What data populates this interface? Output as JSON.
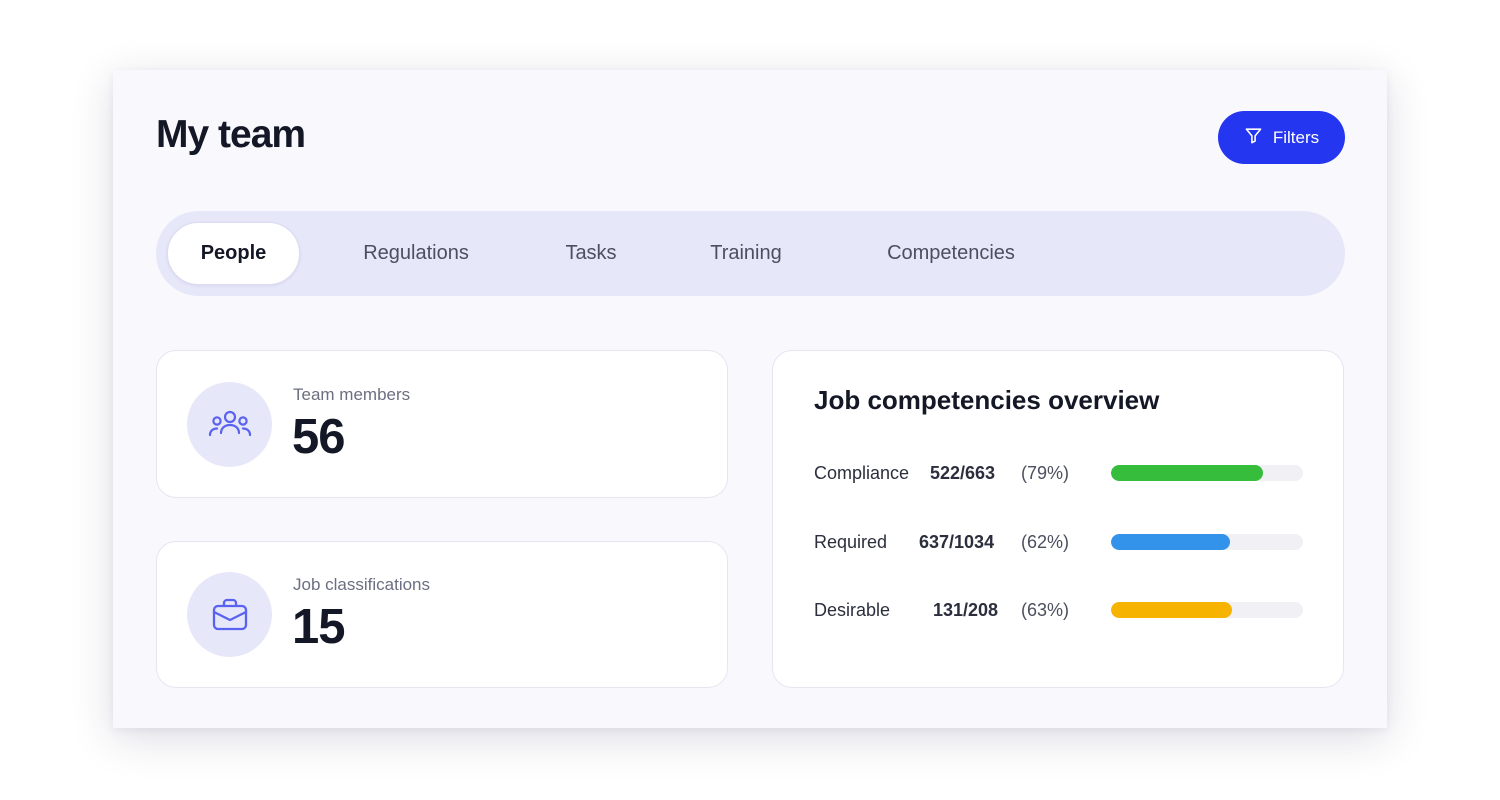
{
  "header": {
    "title": "My team",
    "filters_label": "Filters"
  },
  "tabs": [
    {
      "label": "People",
      "active": true
    },
    {
      "label": "Regulations",
      "active": false
    },
    {
      "label": "Tasks",
      "active": false
    },
    {
      "label": "Training",
      "active": false
    },
    {
      "label": "Competencies",
      "active": false
    }
  ],
  "stats": {
    "team_members": {
      "label": "Team members",
      "value": "56",
      "icon": "people-icon"
    },
    "job_classifications": {
      "label": "Job classifications",
      "value": "15",
      "icon": "briefcase-icon"
    }
  },
  "overview": {
    "title": "Job competencies overview",
    "metrics": [
      {
        "name": "Compliance",
        "count": "522/663",
        "percent": "(79%)",
        "fill": 0.79,
        "color": "#35bd3b"
      },
      {
        "name": "Required",
        "count": "637/1034",
        "percent": "(62%)",
        "fill": 0.62,
        "color": "#3393ea"
      },
      {
        "name": "Desirable",
        "count": "131/208",
        "percent": "(63%)",
        "fill": 0.63,
        "color": "#f6b400"
      }
    ]
  },
  "colors": {
    "accent": "#2536f0",
    "panel_bg": "#f8f8fd",
    "tab_bg": "#e7e7fa",
    "icon_color": "#5a62f0"
  }
}
